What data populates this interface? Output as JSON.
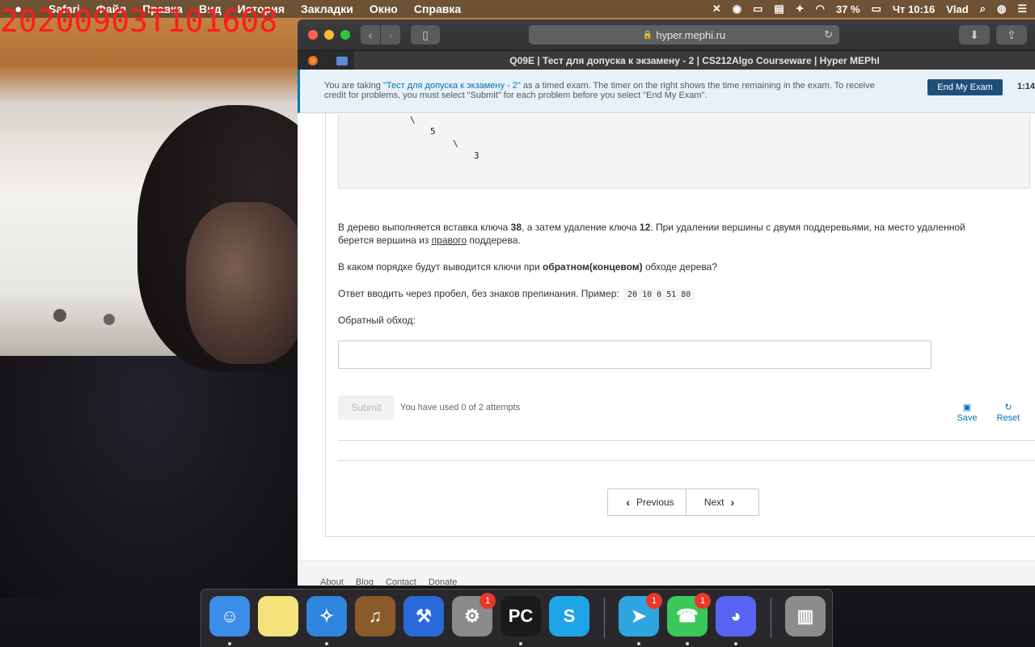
{
  "webcam": {
    "timestamp": "20200903T101608"
  },
  "menubar": {
    "apple": "",
    "menus": [
      "Safari",
      "Файл",
      "Правка",
      "Вид",
      "История",
      "Закладки",
      "Окно",
      "Справка"
    ],
    "battery": "37 %",
    "clock": "Чт 10:16",
    "user": "Vlad"
  },
  "browser": {
    "address": "hyper.mephi.ru",
    "tab_title": "Q09E | Тест для допуска к экзамену - 2 | CS212Algo Courseware | Hyper MEPhI"
  },
  "exam_banner": {
    "text_before": "You are taking ",
    "exam_link": "\"Тест для допуска к экзамену - 2\"",
    "text_after": " as a timed exam. The timer on the right shows the time remaining in the exam. To receive credit for problems, you must select \"Submit\" for each problem before you select \"End My Exam\".",
    "end_button": "End My Exam",
    "timer": "1:14:"
  },
  "problem": {
    "tree_lines": [
      "\\",
      "5",
      "\\",
      "3"
    ],
    "p1_a": "В дерево выполняется вставка ключа ",
    "p1_b": "38",
    "p1_c": ", а затем удаление ключа ",
    "p1_d": "12",
    "p1_e": ". При удалении вершины с двумя поддеревьями, на место удаленной",
    "p1_f": "берется вершина из ",
    "p1_g": "правого",
    "p1_h": " поддерева.",
    "p2_a": "В каком порядке будут выводится ключи при ",
    "p2_b": "обратном(концевом)",
    "p2_c": " обходе дерева?",
    "p3_a": "Ответ вводить через пробел, без знаков препинания. Пример: ",
    "p3_code": "20 10 0 51 80",
    "p4": "Обратный обход:",
    "answer_value": "",
    "submit": "Submit",
    "attempts": "You have used 0 of 2 attempts",
    "save": "Save",
    "reset": "Reset"
  },
  "pager": {
    "previous": "Previous",
    "next": "Next"
  },
  "footer": {
    "links": [
      "About",
      "Blog",
      "Contact",
      "Donate"
    ]
  },
  "dock": {
    "apps": [
      {
        "name": "Finder",
        "color": "#3a8ee8",
        "glyph": "☺"
      },
      {
        "name": "Notes",
        "color": "#f6e27a",
        "glyph": ""
      },
      {
        "name": "Safari",
        "color": "#2e86de",
        "glyph": "✧"
      },
      {
        "name": "GarageBand",
        "color": "#8a5a2a",
        "glyph": "♫"
      },
      {
        "name": "Xcode",
        "color": "#2a6ad8",
        "glyph": "⚒"
      },
      {
        "name": "System Preferences",
        "color": "#8a8a8a",
        "glyph": "⚙",
        "badge": "1"
      },
      {
        "name": "PyCharm",
        "color": "#1a1a1a",
        "glyph": "PC"
      },
      {
        "name": "Skype",
        "color": "#1ea5e8",
        "glyph": "S"
      },
      {
        "name": "Telegram",
        "color": "#2fa5e0",
        "glyph": "➤",
        "badge": "1"
      },
      {
        "name": "FaceTime",
        "color": "#3ac85a",
        "glyph": "☎",
        "badge": "1"
      },
      {
        "name": "Discord",
        "color": "#5865f2",
        "glyph": "◕"
      },
      {
        "name": "Trash",
        "color": "#8c8c8c",
        "glyph": "▥"
      }
    ]
  }
}
